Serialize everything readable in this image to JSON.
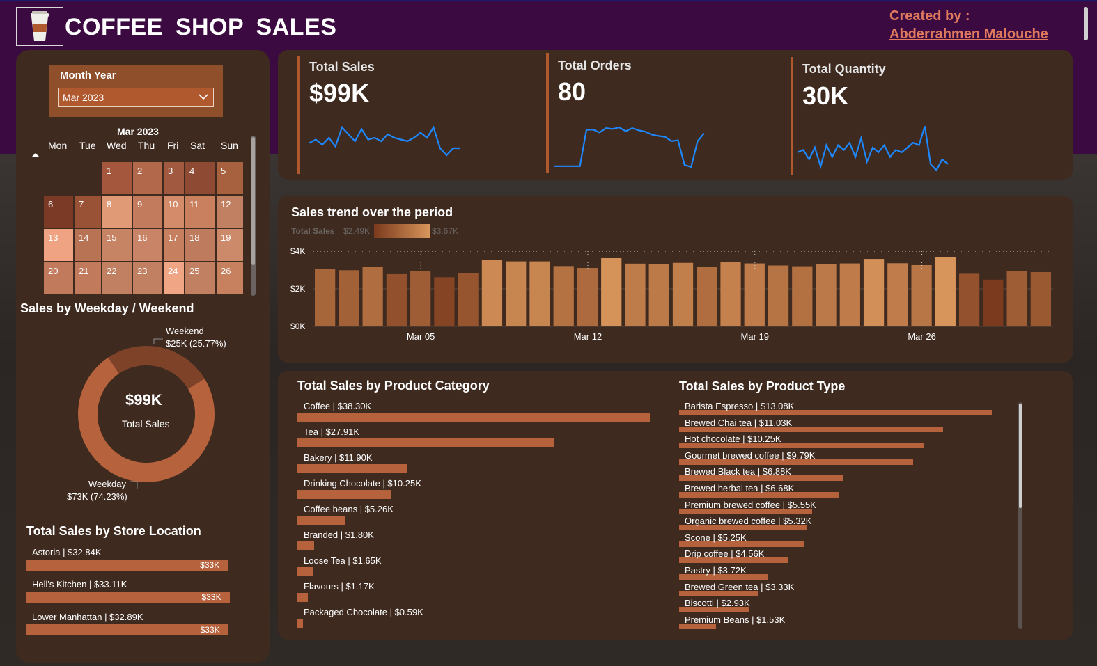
{
  "header": {
    "title": "COFFEE  SHOP SALES",
    "creator_label": "Created by :",
    "creator_name": "Abderrahmen Malouche",
    "logo_icon": "coffee-cup-icon"
  },
  "slicer": {
    "label": "Month Year",
    "value": "Mar 2023"
  },
  "calendar": {
    "month": "Mar 2023",
    "weekdays": [
      "Mon",
      "Tue",
      "Wed",
      "Thu",
      "Fri",
      "Sat",
      "Sun"
    ],
    "weeks": [
      [
        null,
        null,
        "1",
        "2",
        "3",
        "4",
        "5"
      ],
      [
        "6",
        "7",
        "8",
        "9",
        "10",
        "11",
        "12"
      ],
      [
        "13",
        "14",
        "15",
        "16",
        "17",
        "18",
        "19"
      ],
      [
        "20",
        "21",
        "22",
        "23",
        "24",
        "25",
        "26"
      ]
    ],
    "colors": [
      [
        null,
        null,
        "#a4573c",
        "#b2684a",
        "#a15a40",
        "#8f4a33",
        "#a8613f"
      ],
      [
        "#7a3a26",
        "#9a5236",
        "#e19a76",
        "#c27b5d",
        "#d38b69",
        "#c9805f",
        "#c28062"
      ],
      [
        "#f0a382",
        "#b87254",
        "#c68465",
        "#c98366",
        "#c7805f",
        "#bf7b5d",
        "#cd8a6b"
      ],
      [
        "#c27a5c",
        "#c17a5c",
        "#c28063",
        "#c28063",
        "#f0a584",
        "#c28063",
        "#c8815f"
      ]
    ]
  },
  "kpis": [
    {
      "label": "Total Sales",
      "value": "$99K"
    },
    {
      "label": "Total Orders",
      "value": "80"
    },
    {
      "label": "Total Quantity",
      "value": "30K"
    }
  ],
  "weekday_weekend": {
    "title": "Sales by Weekday / Weekend",
    "center_value": "$99K",
    "center_label": "Total Sales",
    "weekend_label": "Weekend",
    "weekend_value": "$25K (25.77%)",
    "weekday_label": "Weekday",
    "weekday_value": "$73K (74.23%)"
  },
  "store_location": {
    "title": "Total Sales by Store Location",
    "items": [
      {
        "label": "Astoria | $32.84K",
        "short": "$33K"
      },
      {
        "label": "Hell's Kitchen | $33.11K",
        "short": "$33K"
      },
      {
        "label": "Lower Manhattan | $32.89K",
        "short": "$33K"
      }
    ]
  },
  "trend": {
    "title": "Sales trend over the period",
    "legend_title": "Total Sales",
    "legend_min": "$2.49K",
    "legend_max": "$3.67K",
    "y_ticks": [
      "$4K",
      "$2K",
      "$0K"
    ],
    "x_ticks": [
      "Mar 05",
      "Mar 12",
      "Mar 19",
      "Mar 26"
    ]
  },
  "category": {
    "title": "Total Sales by Product Category",
    "items": [
      "Coffee | $38.30K",
      "Tea | $27.91K",
      "Bakery | $11.90K",
      "Drinking Chocolate | $10.25K",
      "Coffee beans | $5.26K",
      "Branded | $1.80K",
      "Loose Tea | $1.65K",
      "Flavours | $1.17K",
      "Packaged Chocolate | $0.59K"
    ]
  },
  "product_type": {
    "title": "Total Sales by Product Type",
    "items": [
      "Barista Espresso | $13.08K",
      "Brewed Chai tea | $11.03K",
      "Hot chocolate | $10.25K",
      "Gourmet brewed coffee | $9.79K",
      "Brewed Black tea | $6.88K",
      "Brewed herbal tea | $6.68K",
      "Premium brewed coffee | $5.55K",
      "Organic brewed coffee | $5.32K",
      "Scone | $5.25K",
      "Drip coffee | $4.56K",
      "Pastry | $3.72K",
      "Brewed Green tea | $3.33K",
      "Biscotti | $2.93K",
      "Premium Beans | $1.53K"
    ]
  },
  "chart_data": [
    {
      "type": "bar",
      "title": "Sales trend over the period",
      "ylabel": "Total Sales",
      "ylim": [
        0,
        4000
      ],
      "x": [
        "Mar 01",
        "Mar 02",
        "Mar 03",
        "Mar 04",
        "Mar 05",
        "Mar 06",
        "Mar 07",
        "Mar 08",
        "Mar 09",
        "Mar 10",
        "Mar 11",
        "Mar 12",
        "Mar 13",
        "Mar 14",
        "Mar 15",
        "Mar 16",
        "Mar 17",
        "Mar 18",
        "Mar 19",
        "Mar 20",
        "Mar 21",
        "Mar 22",
        "Mar 23",
        "Mar 24",
        "Mar 25",
        "Mar 26",
        "Mar 27",
        "Mar 28",
        "Mar 29",
        "Mar 30",
        "Mar 31"
      ],
      "values": [
        3050,
        2990,
        3150,
        2780,
        2940,
        2620,
        2830,
        3520,
        3460,
        3460,
        3210,
        3110,
        3630,
        3340,
        3320,
        3380,
        3160,
        3410,
        3350,
        3240,
        3200,
        3300,
        3350,
        3590,
        3360,
        3260,
        3670,
        2800,
        2490,
        2940,
        2890
      ],
      "x_ticks": [
        "Mar 05",
        "Mar 12",
        "Mar 19",
        "Mar 26"
      ],
      "y_ticks": [
        "$4K",
        "$2K",
        "$0K"
      ],
      "reference_line": 4000
    },
    {
      "type": "pie",
      "title": "Sales by Weekday / Weekend",
      "categories": [
        "Weekday",
        "Weekend"
      ],
      "values": [
        73,
        25
      ],
      "percents": [
        74.23,
        25.77
      ]
    },
    {
      "type": "bar",
      "title": "Total Sales by Store Location",
      "categories": [
        "Astoria",
        "Hell's Kitchen",
        "Lower Manhattan"
      ],
      "values": [
        32.84,
        33.11,
        32.89
      ]
    },
    {
      "type": "bar",
      "title": "Total Sales by Product Category",
      "categories": [
        "Coffee",
        "Tea",
        "Bakery",
        "Drinking Chocolate",
        "Coffee beans",
        "Branded",
        "Loose Tea",
        "Flavours",
        "Packaged Chocolate"
      ],
      "values": [
        38.3,
        27.91,
        11.9,
        10.25,
        5.26,
        1.8,
        1.65,
        1.17,
        0.59
      ]
    },
    {
      "type": "bar",
      "title": "Total Sales by Product Type",
      "categories": [
        "Barista Espresso",
        "Brewed Chai tea",
        "Hot chocolate",
        "Gourmet brewed coffee",
        "Brewed Black tea",
        "Brewed herbal tea",
        "Premium brewed coffee",
        "Organic brewed coffee",
        "Scone",
        "Drip coffee",
        "Pastry",
        "Brewed Green tea",
        "Biscotti",
        "Premium Beans"
      ],
      "values": [
        13.08,
        11.03,
        10.25,
        9.79,
        6.88,
        6.68,
        5.55,
        5.32,
        5.25,
        4.56,
        3.72,
        3.33,
        2.93,
        1.53
      ]
    },
    {
      "type": "line",
      "title": "Total Sales",
      "values": [
        0.45,
        0.55,
        0.4,
        0.6,
        0.35,
        0.9,
        0.7,
        0.5,
        0.85,
        0.55,
        0.6,
        0.5,
        0.7,
        0.6,
        0.55,
        0.5,
        0.6,
        0.75,
        0.6,
        0.9,
        0.3,
        0.1,
        0.3,
        0.3
      ]
    },
    {
      "type": "line",
      "title": "Total Orders",
      "values": [
        0.02,
        0.02,
        0.02,
        0.02,
        0.02,
        0.86,
        0.87,
        0.8,
        0.9,
        0.88,
        0.92,
        0.83,
        0.9,
        0.85,
        0.82,
        0.75,
        0.72,
        0.7,
        0.6,
        0.62,
        0.05,
        0.0,
        0.6,
        0.78
      ]
    },
    {
      "type": "line",
      "title": "Total Quantity",
      "values": [
        0.4,
        0.45,
        0.25,
        0.5,
        0.1,
        0.55,
        0.3,
        0.55,
        0.45,
        0.6,
        0.3,
        0.7,
        0.2,
        0.5,
        0.4,
        0.55,
        0.3,
        0.45,
        0.4,
        0.5,
        0.6,
        0.55,
        0.95,
        0.15,
        0.02,
        0.25,
        0.15
      ]
    }
  ]
}
